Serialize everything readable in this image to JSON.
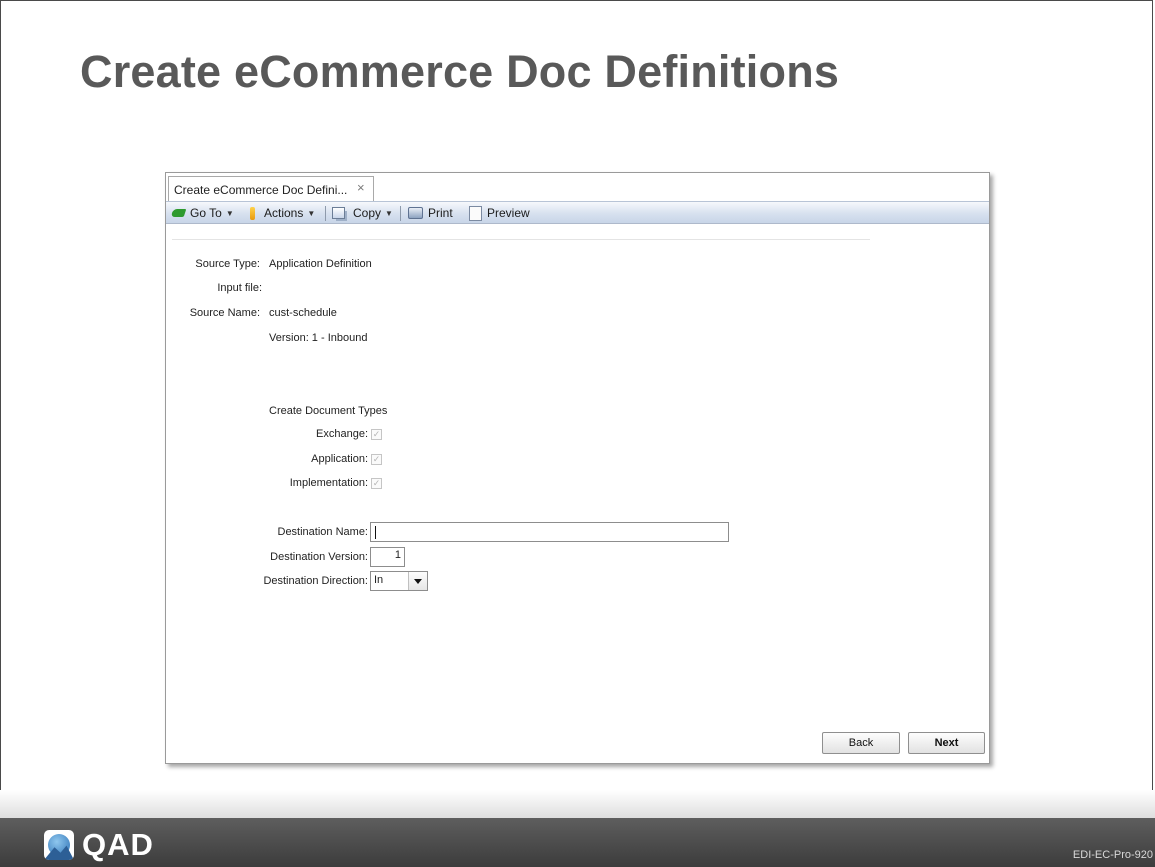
{
  "slide": {
    "title": "Create eCommerce Doc Definitions",
    "footer_code": "EDI-EC-Pro-920",
    "logo_text": "QAD"
  },
  "window": {
    "tab_label": "Create eCommerce Doc Defini...",
    "tab_close": "×",
    "toolbar": {
      "goto": "Go To",
      "actions": "Actions",
      "copy": "Copy",
      "print": "Print",
      "preview": "Preview",
      "dropdown_arrow": "▼"
    }
  },
  "form": {
    "source_type_label": "Source Type:",
    "source_type_value": "Application Definition",
    "input_file_label": "Input file:",
    "source_name_label": "Source Name:",
    "source_name_value": "cust-schedule",
    "version_text": "Version: 1 - Inbound",
    "create_doc_types_heading": "Create Document Types",
    "exchange_label": "Exchange:",
    "application_label": "Application:",
    "implementation_label": "Implementation:",
    "exchange_checked": true,
    "application_checked": true,
    "implementation_checked": true,
    "checkmark": "✓",
    "destination_name_label": "Destination Name:",
    "destination_name_value": "",
    "destination_version_label": "Destination Version:",
    "destination_version_value": "1",
    "destination_direction_label": "Destination Direction:",
    "destination_direction_value": "In"
  },
  "buttons": {
    "back": "Back",
    "next": "Next"
  }
}
